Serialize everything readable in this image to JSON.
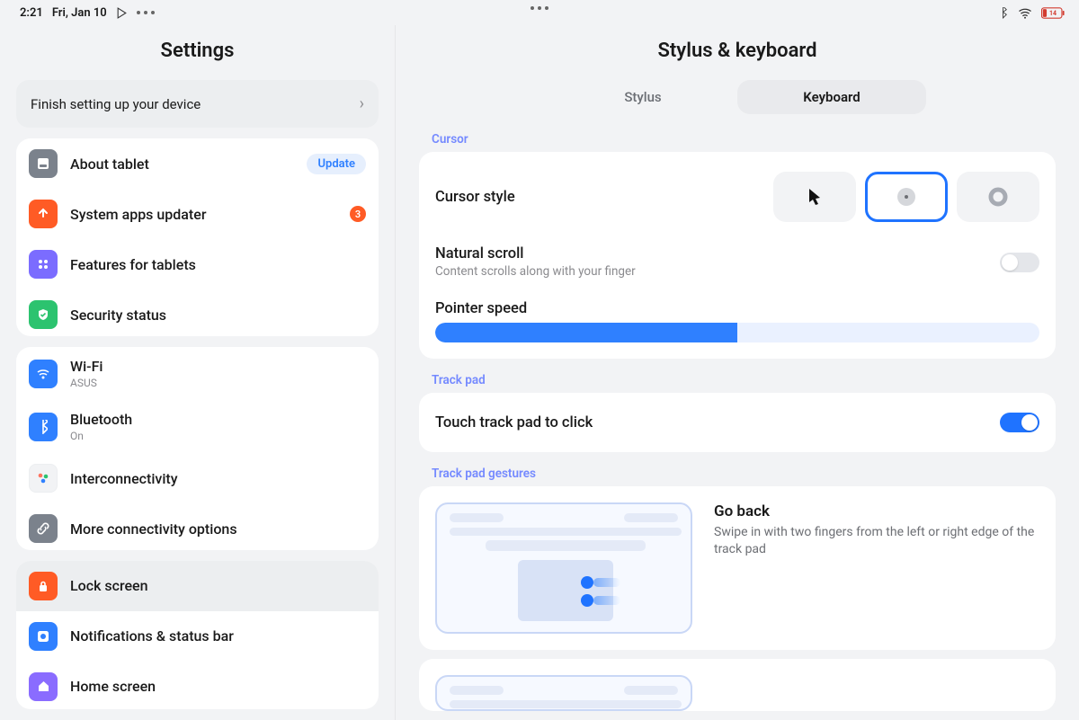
{
  "status": {
    "time": "2:21",
    "date": "Fri, Jan 10",
    "battery": "14"
  },
  "sidebar": {
    "title": "Settings",
    "finish": "Finish setting up your device",
    "update_badge": "Update",
    "sys_badge": "3",
    "items": {
      "about": "About tablet",
      "sys": "System apps updater",
      "features": "Features for tablets",
      "security": "Security status",
      "wifi": "Wi-Fi",
      "wifi_sub": "ASUS",
      "bt": "Bluetooth",
      "bt_sub": "On",
      "inter": "Interconnectivity",
      "more": "More connectivity options",
      "lock": "Lock screen",
      "notif": "Notifications & status bar",
      "home": "Home screen"
    }
  },
  "main": {
    "title": "Stylus & keyboard",
    "tabs": {
      "stylus": "Stylus",
      "keyboard": "Keyboard"
    },
    "sections": {
      "cursor": "Cursor",
      "trackpad": "Track pad",
      "gestures": "Track pad gestures"
    },
    "cursor_style": "Cursor style",
    "natural_scroll": "Natural scroll",
    "natural_scroll_sub": "Content scrolls along with your finger",
    "pointer_speed": "Pointer speed",
    "pointer_speed_value": 50,
    "touch_click": "Touch track pad to click",
    "gesture": {
      "title": "Go back",
      "desc": "Swipe in with two fingers from the left or right edge of the track pad"
    }
  }
}
